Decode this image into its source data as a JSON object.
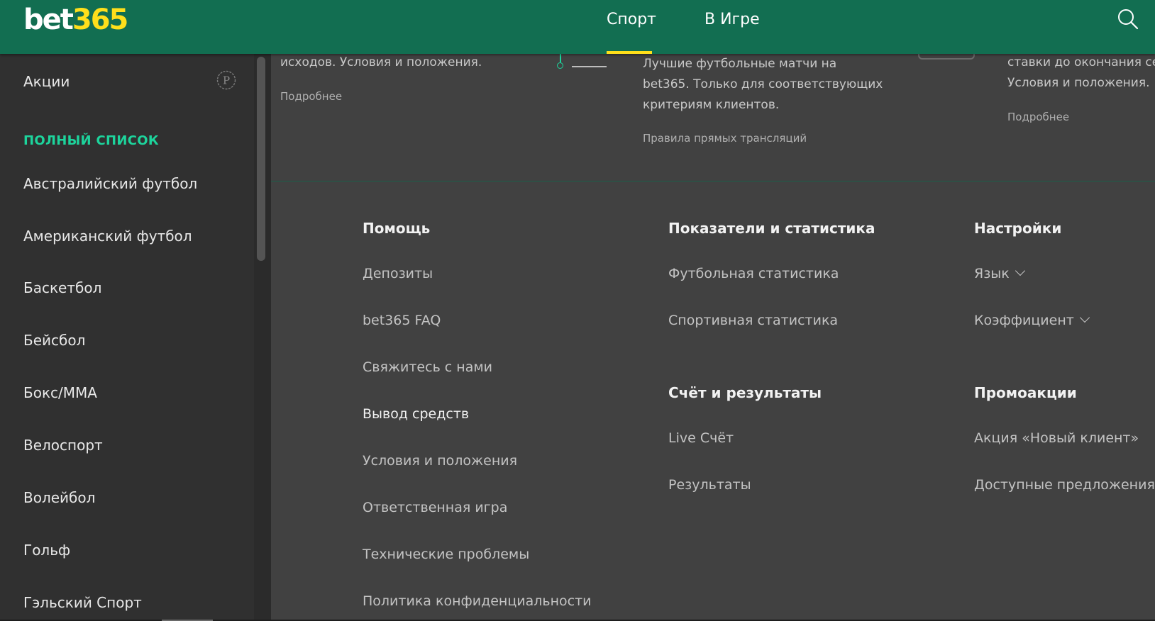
{
  "header": {
    "logo_part1": "bet",
    "logo_part2": "365",
    "tabs": [
      {
        "label": "Спорт",
        "active": true
      },
      {
        "label": "В Игре",
        "active": false
      }
    ],
    "search_icon": "search-icon"
  },
  "sidebar": {
    "promo": {
      "label": "Акции",
      "icon": "promo-p-icon"
    },
    "section_title": "ПОЛНЫЙ СПИСОК",
    "items": [
      "Австралийский футбол",
      "Американский футбол",
      "Баскетбол",
      "Бейсбол",
      "Бокс/ММА",
      "Велоспорт",
      "Волейбол",
      "Гольф",
      "Гэльский Спорт"
    ]
  },
  "promos": {
    "col1": {
      "line1": "исходов. Условия и положения.",
      "link": "Подробнее"
    },
    "col2": {
      "line1": "Лучшие футбольные матчи на",
      "line2": "bet365. Только для соответствующих",
      "line3": "критериям клиентов.",
      "link": "Правила прямых трансляций"
    },
    "col3": {
      "line1": "ставки до окончания се",
      "line2": "Условия и положения.",
      "link": "Подробнее"
    }
  },
  "footer": {
    "help": {
      "title": "Помощь",
      "links": [
        "Депозиты",
        "bet365 FAQ",
        "Свяжитесь с нами",
        "Вывод средств",
        "Условия и положения",
        "Ответственная игра",
        "Технические проблемы",
        "Политика конфиденциальности"
      ]
    },
    "stats": {
      "title": "Показатели и статистика",
      "links": [
        "Футбольная статистика",
        "Спортивная статистика"
      ]
    },
    "scores": {
      "title": "Счёт и результаты",
      "links": [
        "Live Счёт",
        "Результаты"
      ]
    },
    "settings": {
      "title": "Настройки",
      "language_label": "Язык",
      "odds_label": "Коэффициент"
    },
    "promotions": {
      "title": "Промоакции",
      "links": [
        "Акция «Новый клиент»",
        "Доступные предложения"
      ]
    }
  },
  "colors": {
    "header_green": "#126e51",
    "accent_yellow": "#ffdf1b",
    "accent_green": "#1dd49c"
  }
}
